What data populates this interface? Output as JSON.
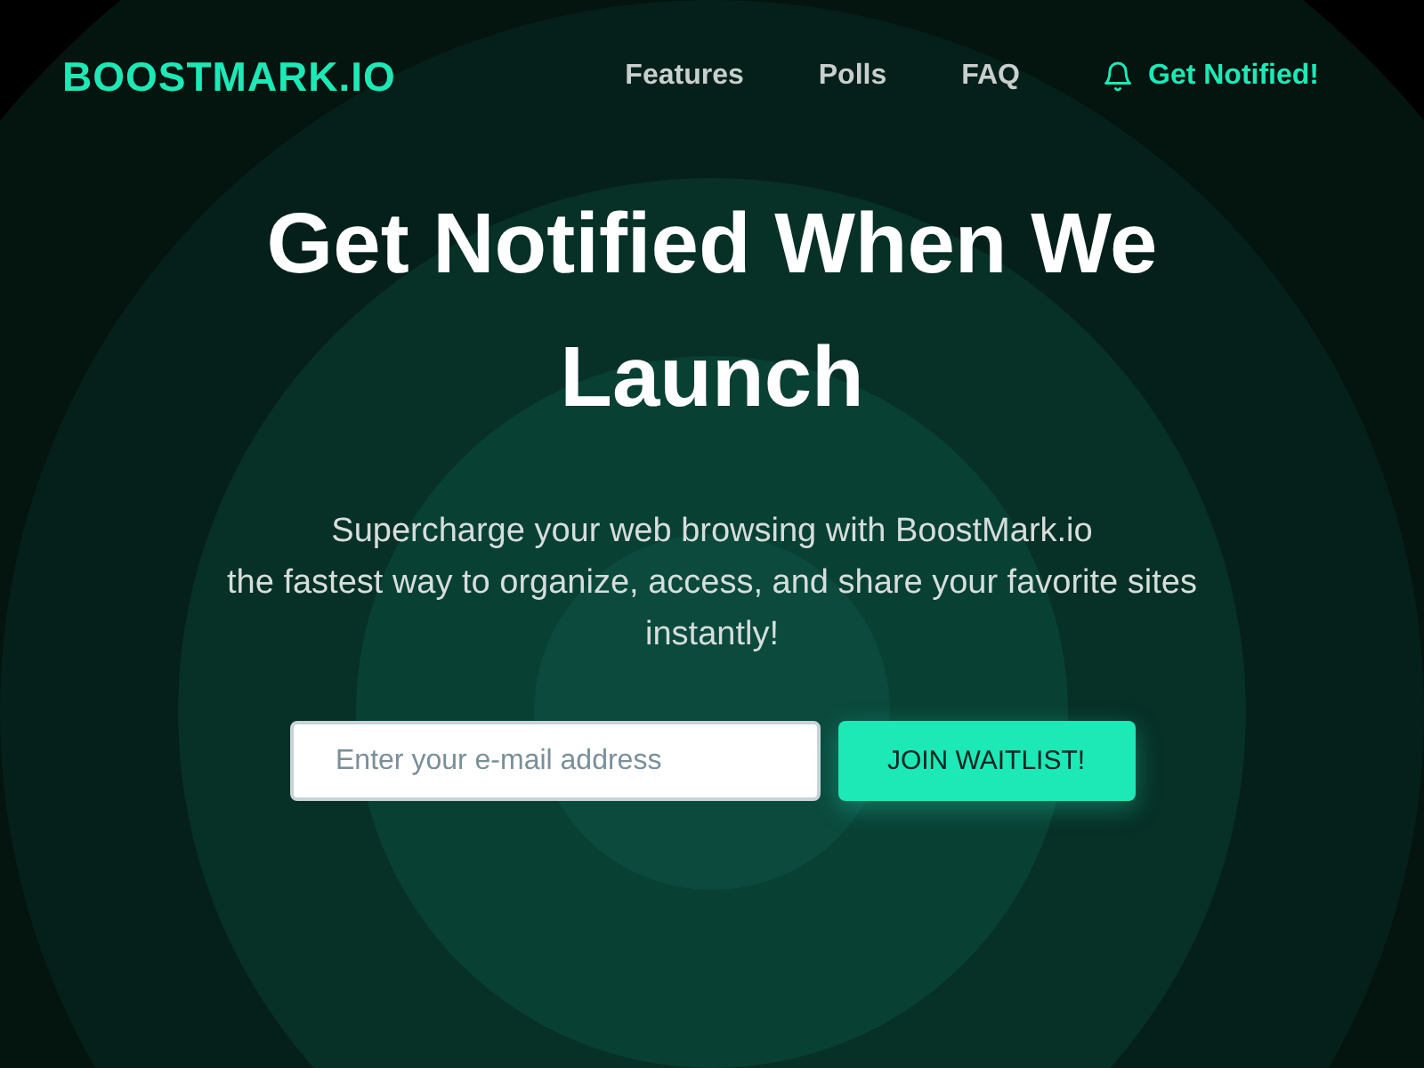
{
  "header": {
    "logo": "BOOSTMARK.IO",
    "nav": [
      {
        "label": "Features"
      },
      {
        "label": "Polls"
      },
      {
        "label": "FAQ"
      }
    ],
    "cta": {
      "label": "Get Notified!"
    }
  },
  "hero": {
    "title": "Get Notified When We Launch",
    "subtitle_lines": [
      "Supercharge your web browsing with BoostMark.io",
      "the fastest way to organize, access, and share your favorite sites instantly!"
    ]
  },
  "signup": {
    "email": {
      "placeholder": "Enter your e-mail address"
    },
    "button": "JOIN WAITLIST!"
  }
}
